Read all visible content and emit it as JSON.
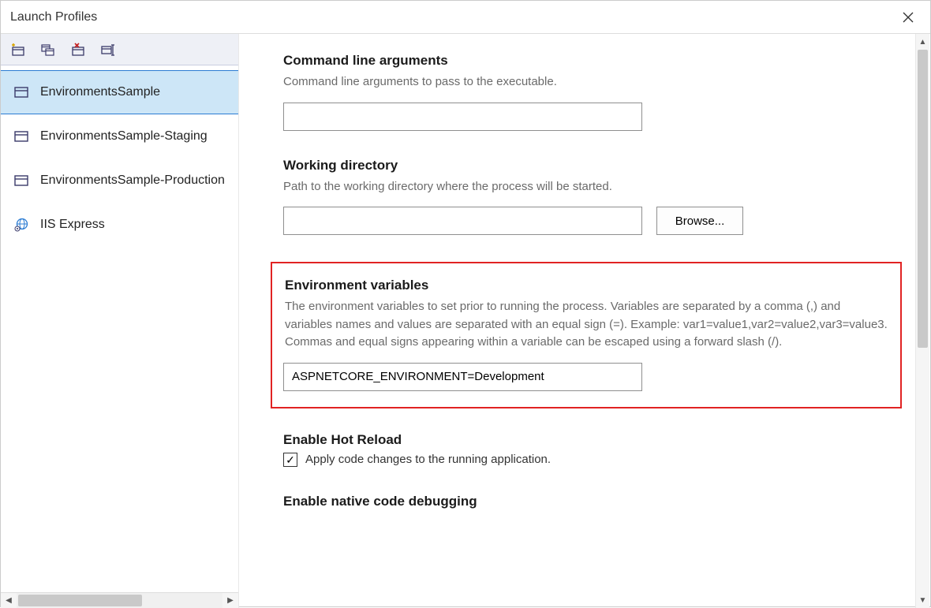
{
  "window": {
    "title": "Launch Profiles"
  },
  "toolbar": {
    "buttons": [
      "new-profile",
      "duplicate-profile",
      "delete-profile",
      "rename-profile"
    ]
  },
  "profiles": {
    "items": [
      {
        "label": "EnvironmentsSample",
        "selected": true,
        "icon": "window"
      },
      {
        "label": "EnvironmentsSample-Staging",
        "selected": false,
        "icon": "window"
      },
      {
        "label": "EnvironmentsSample-Production",
        "selected": false,
        "icon": "window"
      },
      {
        "label": "IIS Express",
        "selected": false,
        "icon": "globe"
      }
    ]
  },
  "sections": {
    "cmdline": {
      "title": "Command line arguments",
      "desc": "Command line arguments to pass to the executable.",
      "value": ""
    },
    "workdir": {
      "title": "Working directory",
      "desc": "Path to the working directory where the process will be started.",
      "value": "",
      "browse": "Browse..."
    },
    "envvars": {
      "title": "Environment variables",
      "desc": "The environment variables to set prior to running the process. Variables are separated by a comma (,) and variables names and values are separated with an equal sign (=). Example: var1=value1,var2=value2,var3=value3. Commas and equal signs appearing within a variable can be escaped using a forward slash (/).",
      "value": "ASPNETCORE_ENVIRONMENT=Development"
    },
    "hotreload": {
      "title": "Enable Hot Reload",
      "checkbox_label": "Apply code changes to the running application.",
      "checked": true
    },
    "nativedebug": {
      "title": "Enable native code debugging"
    }
  }
}
